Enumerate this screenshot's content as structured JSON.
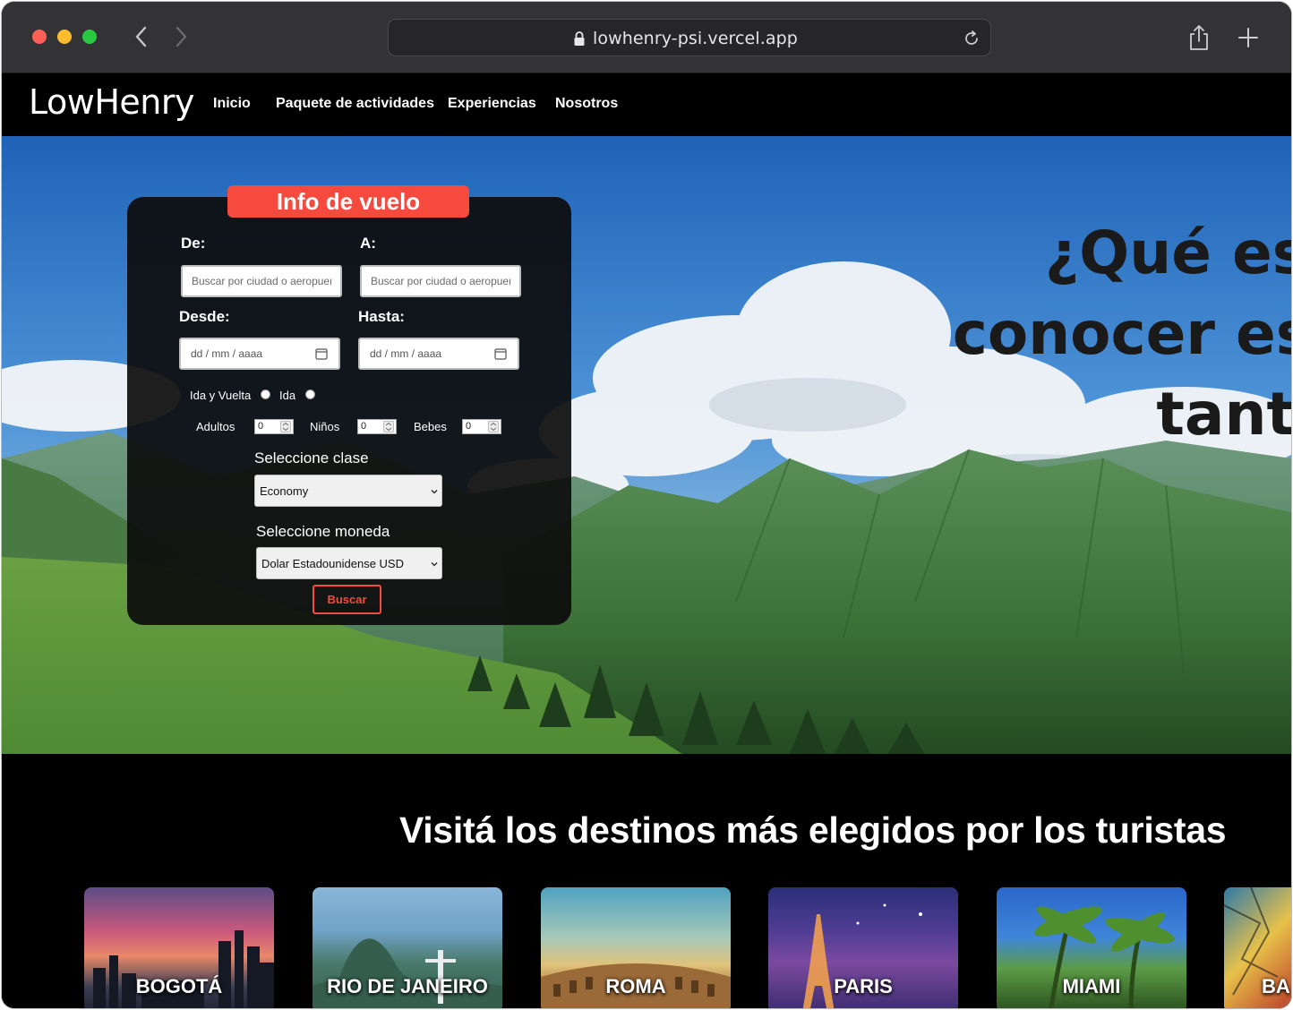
{
  "browser": {
    "url": "lowhenry-psi.vercel.app"
  },
  "site": {
    "logo": "LowHenry",
    "nav": [
      "Inicio",
      "Paquete de actividades",
      "Experiencias",
      "Nosotros"
    ]
  },
  "hero": {
    "headline_lines": [
      "¿Qué es",
      "conocer es",
      "tant"
    ]
  },
  "flight_form": {
    "title": "Info de vuelo",
    "from_label": "De:",
    "to_label": "A:",
    "from_placeholder": "Buscar por ciudad o aeropuerto",
    "to_placeholder": "Buscar por ciudad o aeropuerto",
    "depart_label": "Desde:",
    "return_label": "Hasta:",
    "depart_value": "dd / mm / aaaa",
    "return_value": "dd / mm / aaaa",
    "trip_round": "Ida y Vuelta",
    "trip_oneway": "Ida",
    "adults_label": "Adultos",
    "adults_value": "0",
    "children_label": "Niños",
    "children_value": "0",
    "infants_label": "Bebes",
    "infants_value": "0",
    "class_label": "Seleccione clase",
    "class_value": "Economy",
    "currency_label": "Seleccione moneda",
    "currency_value": "Dolar Estadounidense USD",
    "search_button": "Buscar",
    "accent_color": "#f64a3e"
  },
  "destinations": {
    "title": "Visitá los destinos más elegidos por los turistas",
    "cards": [
      "BOGOTÁ",
      "RIO DE JANEIRO",
      "ROMA",
      "PARIS",
      "MIAMI",
      "BA"
    ]
  }
}
